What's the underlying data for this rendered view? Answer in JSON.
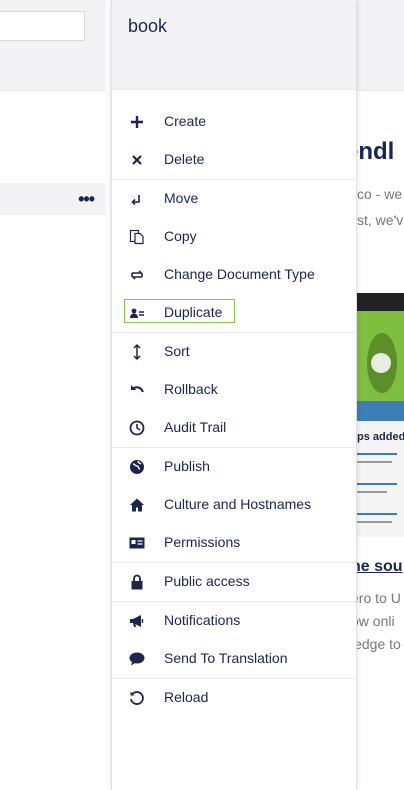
{
  "dialog": {
    "title": "book",
    "items": [
      {
        "label": "Create",
        "icon": "plus-icon"
      },
      {
        "label": "Delete",
        "icon": "close-icon"
      },
      {
        "label": "Move",
        "icon": "move-icon"
      },
      {
        "label": "Copy",
        "icon": "copy-icon"
      },
      {
        "label": "Change Document Type",
        "icon": "change-type-icon"
      },
      {
        "label": "Duplicate",
        "icon": "duplicate-icon"
      },
      {
        "label": "Sort",
        "icon": "sort-icon"
      },
      {
        "label": "Rollback",
        "icon": "undo-icon"
      },
      {
        "label": "Audit Trail",
        "icon": "clock-icon"
      },
      {
        "label": "Publish",
        "icon": "globe-icon"
      },
      {
        "label": "Culture and Hostnames",
        "icon": "home-icon"
      },
      {
        "label": "Permissions",
        "icon": "id-card-icon"
      },
      {
        "label": "Public access",
        "icon": "lock-icon"
      },
      {
        "label": "Notifications",
        "icon": "megaphone-icon"
      },
      {
        "label": "Send To Translation",
        "icon": "chat-bubble-icon"
      },
      {
        "label": "Reload",
        "icon": "reload-icon"
      }
    ]
  },
  "background": {
    "heading": "endl",
    "lines": [
      "co - we",
      "st, we'v"
    ],
    "image_caption": "ps added",
    "link": "he sou",
    "lines2": [
      "ero to U",
      "ow onli",
      "ledge to"
    ]
  },
  "tree": {
    "row_actions": "•••"
  },
  "colors": {
    "text": "#1b264f",
    "header_bg": "#f3f3f5",
    "border": "#e9e9eb",
    "focus": "#8bc34a"
  }
}
